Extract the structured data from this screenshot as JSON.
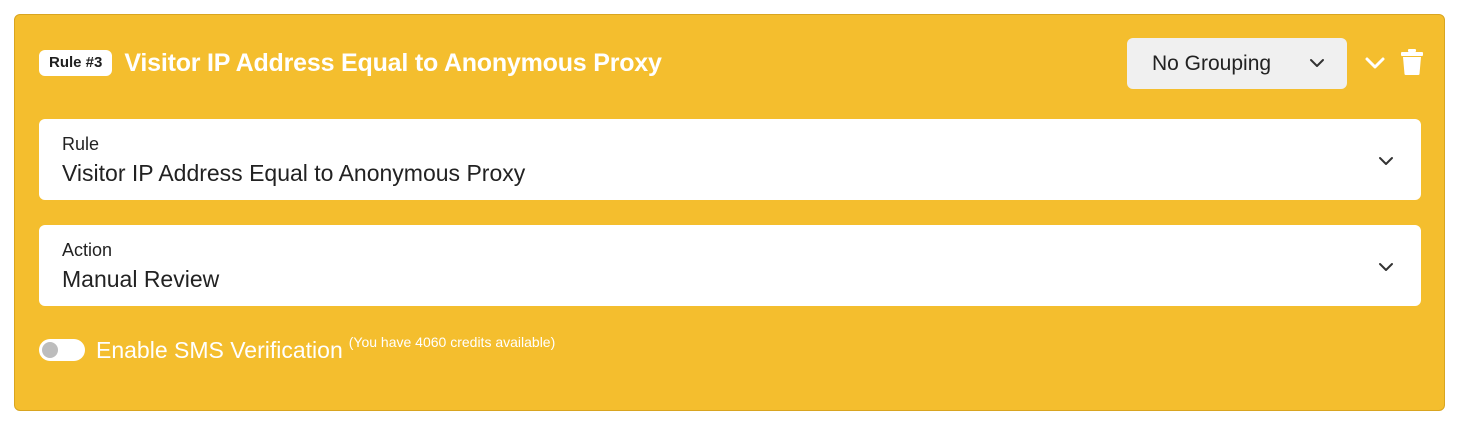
{
  "rule_card": {
    "badge": "Rule #3",
    "title": "Visitor IP Address Equal to Anonymous Proxy",
    "grouping": {
      "selected": "No Grouping",
      "icon": "chevron-down-icon"
    },
    "collapse_icon": "chevron-down-icon",
    "delete_icon": "trash-icon",
    "rule_field": {
      "label": "Rule",
      "value": "Visitor IP Address Equal to Anonymous Proxy"
    },
    "action_field": {
      "label": "Action",
      "value": "Manual Review"
    },
    "sms": {
      "enabled": false,
      "label": "Enable SMS Verification",
      "credits_note": "(You have 4060 credits available)"
    }
  },
  "colors": {
    "card_background": "#f4be2e",
    "field_background": "#ffffff",
    "select_background": "#f0f0f0",
    "text_dark": "#222222",
    "text_light": "#ffffff"
  }
}
